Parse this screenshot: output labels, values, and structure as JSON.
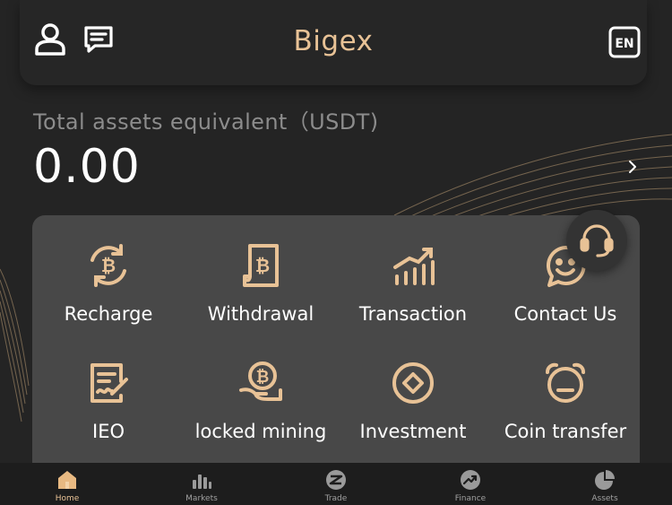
{
  "header": {
    "title": "Bigex",
    "language_badge": "EN"
  },
  "assets": {
    "label": "Total assets equivalent（USDT)",
    "value": "0.00"
  },
  "menu": [
    {
      "label": "Recharge",
      "icon": "bitcoin-cycle-icon"
    },
    {
      "label": "Withdrawal",
      "icon": "bitcoin-document-icon"
    },
    {
      "label": "Transaction",
      "icon": "trend-chart-icon"
    },
    {
      "label": "Contact Us",
      "icon": "smiley-chat-icon"
    },
    {
      "label": "IEO",
      "icon": "signature-document-icon"
    },
    {
      "label": "locked mining",
      "icon": "bitcoin-hand-icon"
    },
    {
      "label": "Investment",
      "icon": "diamond-circle-icon"
    },
    {
      "label": "Coin transfer",
      "icon": "alarm-clock-icon"
    }
  ],
  "tabs": [
    {
      "label": "Home",
      "icon": "home-icon",
      "active": true
    },
    {
      "label": "Markets",
      "icon": "bar-chart-icon",
      "active": false
    },
    {
      "label": "Trade",
      "icon": "trade-icon",
      "active": false
    },
    {
      "label": "Finance",
      "icon": "finance-icon",
      "active": false
    },
    {
      "label": "Assets",
      "icon": "pie-chart-icon",
      "active": false
    }
  ],
  "colors": {
    "background": "#242424",
    "accent": "#e8c296",
    "panel": "#484848",
    "tabbar": "#1d1d1d"
  }
}
